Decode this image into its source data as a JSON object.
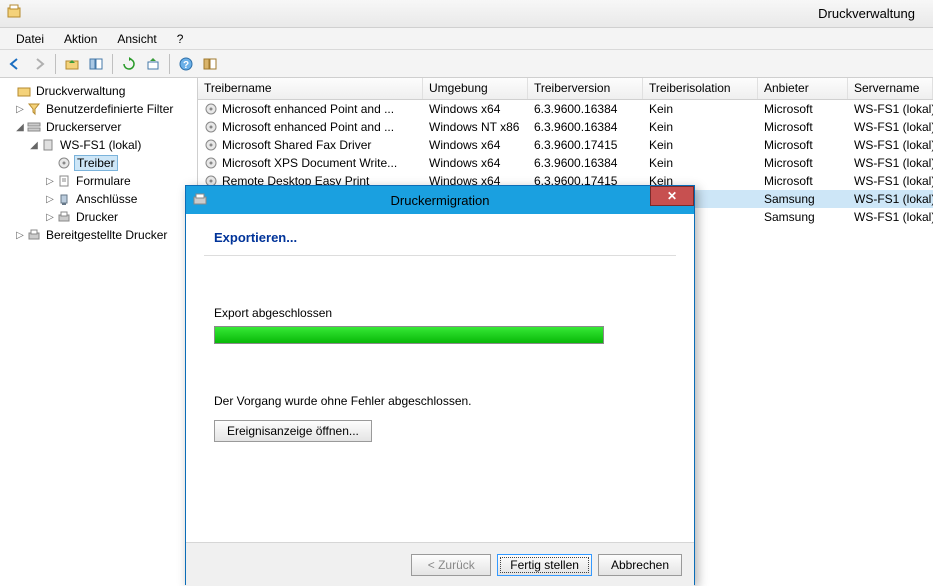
{
  "window": {
    "title": "Druckverwaltung"
  },
  "menu": {
    "file": "Datei",
    "action": "Aktion",
    "view": "Ansicht",
    "help": "?"
  },
  "tree": {
    "root": "Druckverwaltung",
    "customFilters": "Benutzerdefinierte Filter",
    "printServers": "Druckerserver",
    "server": "WS-FS1 (lokal)",
    "drivers": "Treiber",
    "forms": "Formulare",
    "ports": "Anschlüsse",
    "printers": "Drucker",
    "deployed": "Bereitgestellte Drucker"
  },
  "list": {
    "headers": {
      "name": "Treibername",
      "env": "Umgebung",
      "ver": "Treiberversion",
      "iso": "Treiberisolation",
      "vendor": "Anbieter",
      "server": "Servername"
    },
    "rows": [
      {
        "name": "Microsoft enhanced Point and ...",
        "env": "Windows x64",
        "ver": "6.3.9600.16384",
        "iso": "Kein",
        "vendor": "Microsoft",
        "server": "WS-FS1 (lokal)"
      },
      {
        "name": "Microsoft enhanced Point and ...",
        "env": "Windows NT x86",
        "ver": "6.3.9600.16384",
        "iso": "Kein",
        "vendor": "Microsoft",
        "server": "WS-FS1 (lokal)"
      },
      {
        "name": "Microsoft Shared Fax Driver",
        "env": "Windows x64",
        "ver": "6.3.9600.17415",
        "iso": "Kein",
        "vendor": "Microsoft",
        "server": "WS-FS1 (lokal)"
      },
      {
        "name": "Microsoft XPS Document Write...",
        "env": "Windows x64",
        "ver": "6.3.9600.16384",
        "iso": "Kein",
        "vendor": "Microsoft",
        "server": "WS-FS1 (lokal)"
      },
      {
        "name": "Remote Desktop Easy Print",
        "env": "Windows x64",
        "ver": "6.3.9600.17415",
        "iso": "Kein",
        "vendor": "Microsoft",
        "server": "WS-FS1 (lokal)"
      },
      {
        "name": "",
        "env": "",
        "ver": "",
        "iso": "",
        "vendor": "Samsung",
        "server": "WS-FS1 (lokal)"
      },
      {
        "name": "",
        "env": "",
        "ver": "",
        "iso": "",
        "vendor": "Samsung",
        "server": "WS-FS1 (lokal)"
      }
    ]
  },
  "modal": {
    "title": "Druckermigration",
    "heading": "Exportieren...",
    "status": "Export abgeschlossen",
    "progressPercent": 100,
    "message": "Der Vorgang wurde ohne Fehler abgeschlossen.",
    "eventViewer": "Ereignisanzeige öffnen...",
    "back": "< Zurück",
    "finish": "Fertig stellen",
    "cancel": "Abbrechen"
  }
}
